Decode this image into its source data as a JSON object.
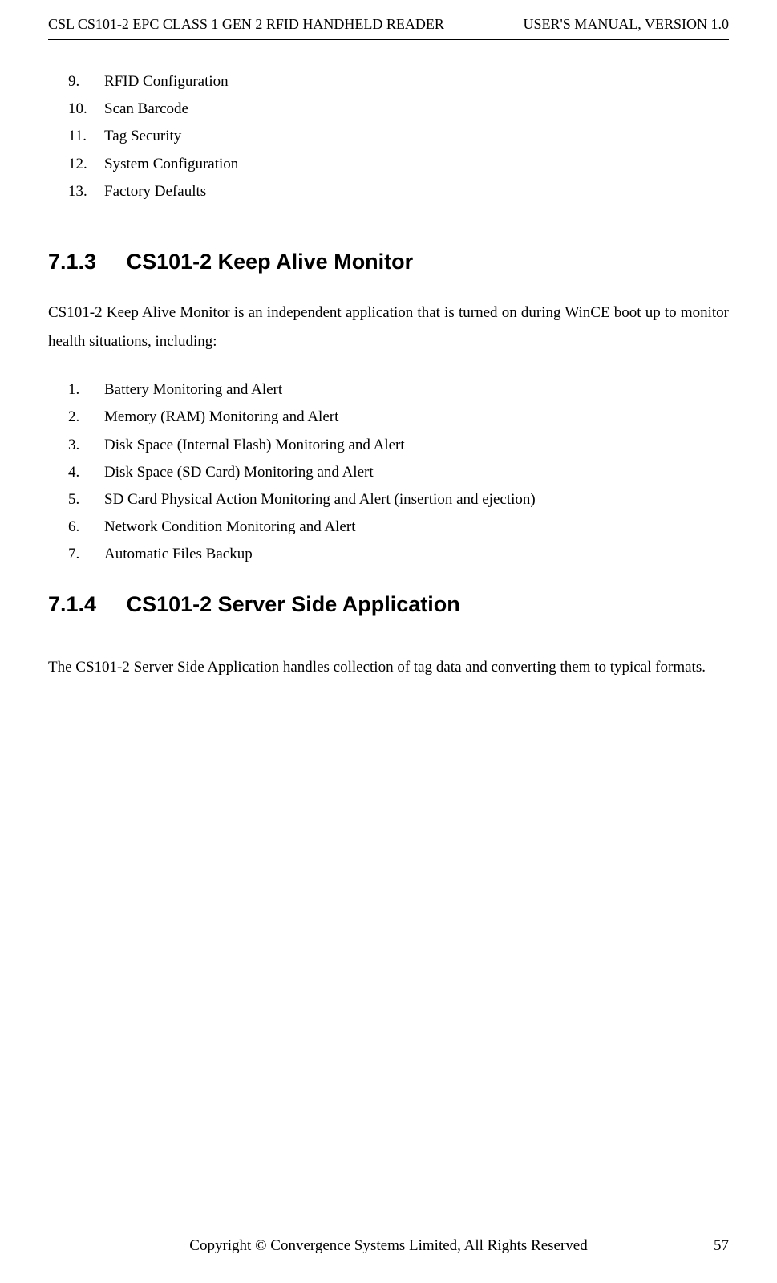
{
  "header": {
    "left": "CSL CS101-2 EPC CLASS 1 GEN 2 RFID HANDHELD READER",
    "right": "USER'S  MANUAL,  VERSION  1.0"
  },
  "topList": [
    {
      "num": "9.",
      "text": "RFID Configuration"
    },
    {
      "num": "10.",
      "text": "Scan Barcode"
    },
    {
      "num": "11.",
      "text": "Tag Security"
    },
    {
      "num": "12.",
      "text": "System Configuration"
    },
    {
      "num": "13.",
      "text": "Factory Defaults"
    }
  ],
  "section713": {
    "num": "7.1.3",
    "title": "CS101-2 Keep Alive Monitor",
    "intro": "CS101-2 Keep Alive Monitor is an independent application that is turned on during WinCE boot up to monitor health situations, including:",
    "items": [
      {
        "num": "1.",
        "text": "Battery Monitoring and Alert"
      },
      {
        "num": "2.",
        "text": "Memory (RAM) Monitoring and Alert"
      },
      {
        "num": "3.",
        "text": "Disk Space (Internal Flash) Monitoring and Alert"
      },
      {
        "num": "4.",
        "text": "Disk Space (SD Card) Monitoring and Alert"
      },
      {
        "num": "5.",
        "text": "SD Card Physical Action Monitoring and Alert (insertion and ejection)"
      },
      {
        "num": "6.",
        "text": "Network Condition Monitoring and Alert"
      },
      {
        "num": "7.",
        "text": "Automatic Files Backup"
      }
    ]
  },
  "section714": {
    "num": "7.1.4",
    "title": "CS101-2 Server Side Application",
    "body": "The CS101-2 Server Side Application handles collection of tag data and converting them to typical formats."
  },
  "footer": {
    "center": "Copyright © Convergence Systems Limited, All Rights Reserved",
    "page": "57"
  }
}
